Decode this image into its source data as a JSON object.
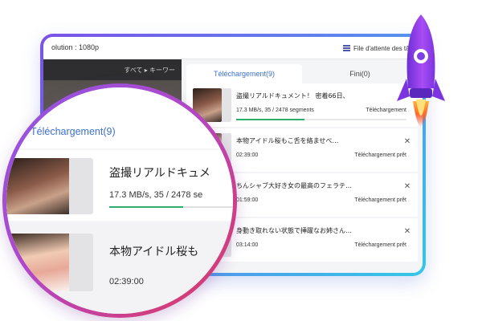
{
  "window": {
    "resolution_label": "olution : 1080p",
    "queue_label": "File d'attente des tâch",
    "search_label": "すべて ▸  キーワー"
  },
  "tabs": [
    {
      "label": "Téléchargement(9)",
      "active": true
    },
    {
      "label": "Fini(0)",
      "active": false
    }
  ],
  "downloads": [
    {
      "title": "盗撮リアルドキュメント！ 密着66日、",
      "meta": "17.3 MB/s, 35 / 2478 segments",
      "status": "Téléchargement",
      "progress": 0.014,
      "closable": false
    },
    {
      "title": "本物アイドル桜もこ舌を絡ませべ…",
      "meta": "02:39:00",
      "status": "Téléchargement prêt",
      "progress": null,
      "closable": true
    },
    {
      "title": "ちんシャブ大好き女の最高のフェラテ…",
      "meta": "01:59:00",
      "status": "Téléchargement prêt",
      "progress": null,
      "closable": true
    },
    {
      "title": "身動き取れない状態で挿躍なお姉さん…",
      "meta": "03:14:00",
      "status": "Téléchargement prêt",
      "progress": null,
      "closable": true
    }
  ],
  "magnifier": {
    "tab_label": "Téléchargement(9)",
    "row1_title": "盗撮リアルドキュメ",
    "row1_meta": "17.3 MB/s, 35 / 2478 se",
    "row1_progress": 0.014,
    "row2_title": "本物アイドル桜も",
    "row2_meta": "02:39:00"
  },
  "icons": {
    "queue": "list-icon",
    "close": "close-icon",
    "rocket": "rocket-icon"
  },
  "colors": {
    "accent_blue": "#3d6fd0",
    "progress_green": "#2fae6a",
    "frame_gradient_start": "#7b52e8",
    "frame_gradient_end": "#33c8e6",
    "magnifier_gradient_start": "#8c57e6",
    "magnifier_gradient_end": "#e0395c",
    "rocket_body": "#9b3ef0"
  }
}
